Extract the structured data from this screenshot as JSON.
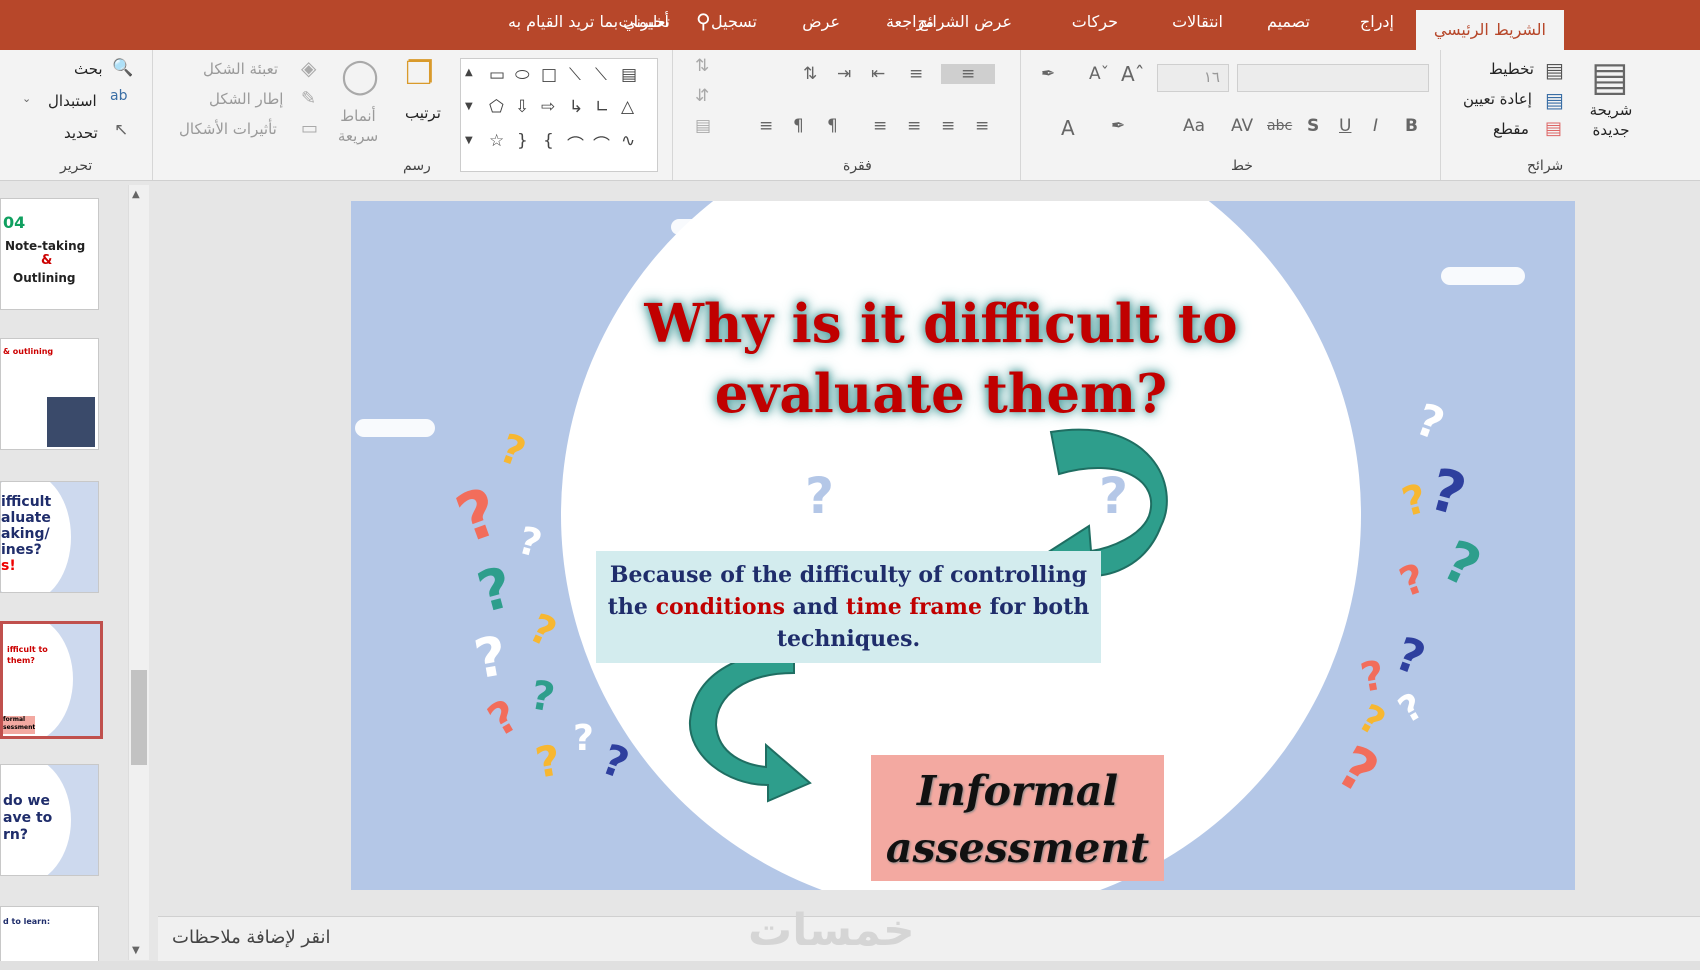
{
  "tabs": [
    {
      "label": "الشريط الرئيسي",
      "active": true
    },
    {
      "label": "إدراج"
    },
    {
      "label": "تصميم"
    },
    {
      "label": "انتقالات"
    },
    {
      "label": "حركات"
    },
    {
      "label": "عرض الشرائح"
    },
    {
      "label": "مراجعة"
    },
    {
      "label": "عرض"
    },
    {
      "label": "تسجيل"
    },
    {
      "label": "تعليمات"
    }
  ],
  "tell_me": "أخبرني بما تريد القيام به",
  "ribbon": {
    "slides_group": {
      "label": "شرائح",
      "new_slide": "شريحة جديدة",
      "layout": "تخطيط",
      "reset": "إعادة تعيين",
      "section": "مقطع"
    },
    "font_group": {
      "label": "خط",
      "font_size": "١٦"
    },
    "paragraph_group": {
      "label": "فقرة"
    },
    "drawing_group": {
      "label": "رسم",
      "arrange": "ترتيب",
      "quick_styles": "أنماط سريعة",
      "fill": "تعبئة الشكل",
      "outline": "إطار الشكل",
      "effects": "تأثيرات الأشكال"
    },
    "editing_group": {
      "label": "تحرير",
      "find": "بحث",
      "replace": "استبدال",
      "select": "تحديد"
    }
  },
  "thumbnails": [
    {
      "line1": "04",
      "line2": "Note-taking",
      "line3": "&",
      "line4": "Outlining"
    },
    {
      "line1": "& outlining"
    },
    {
      "line1": "ifficult",
      "line2": "aluate",
      "line3": "aking/",
      "line4": "ines?",
      "line5": "s!"
    },
    {
      "line1": "ifficult to",
      "line2": "them?",
      "line3": "formal",
      "line4": "sessment"
    },
    {
      "line1": "do we",
      "line2": "ave to",
      "line3": "rn?"
    },
    {
      "line1": "d to learn:"
    }
  ],
  "slide": {
    "title_line1": "Why is it difficult to",
    "title_line2": "evaluate them?",
    "body_part1": "Because of the difficulty of controlling the ",
    "body_red1": "conditions",
    "body_part2": " and ",
    "body_red2": "time frame",
    "body_part3": " for both techniques.",
    "answer_line1": "Informal",
    "answer_line2": "assessment"
  },
  "notes_placeholder": "انقر لإضافة ملاحظات",
  "watermark": "خمسات",
  "colors": {
    "accent": "#b7472a",
    "teal": "#2e8b80",
    "title_red": "#c00000",
    "slide_bg": "#b4c7e7"
  }
}
